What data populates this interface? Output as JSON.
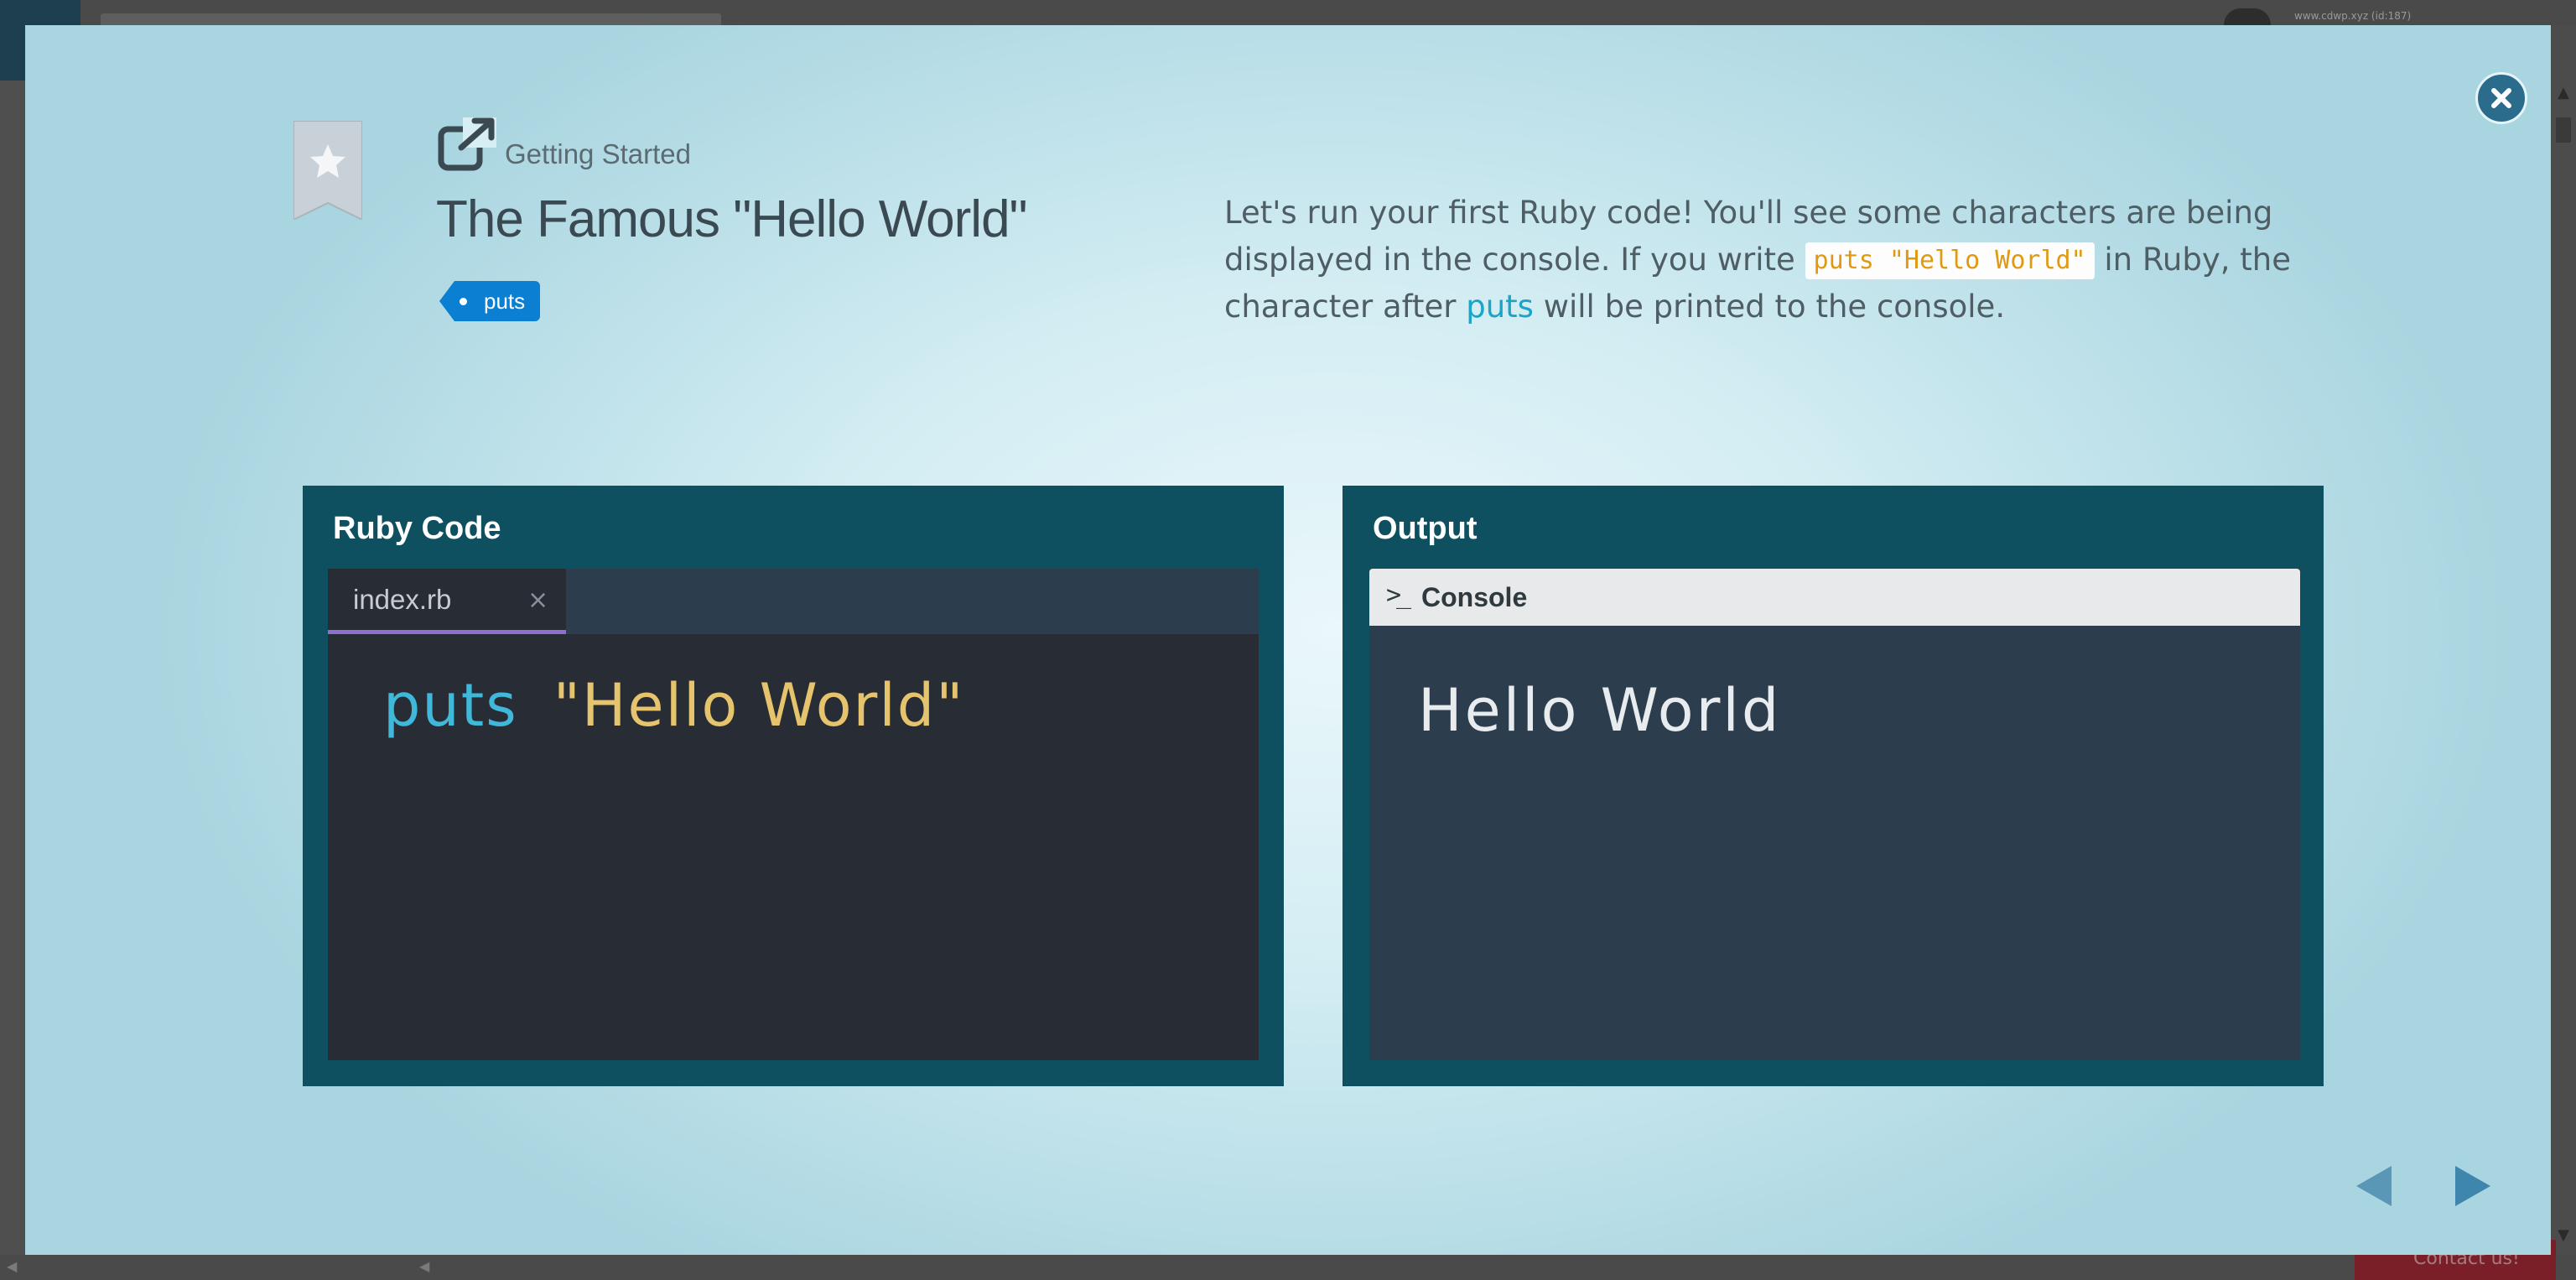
{
  "background": {
    "user_text": "www.cdwp.xyz (id:187)",
    "contact_label": "Contact us!"
  },
  "modal": {
    "icons": {
      "bookmark": "star-bookmark-icon",
      "external": "external-link-icon",
      "close": "close-icon",
      "prev": "arrow-left-icon",
      "next": "arrow-right-icon"
    },
    "category": "Getting Started",
    "title": "The Famous \"Hello World\"",
    "tag": "puts",
    "description": {
      "part1": "Let's run your first Ruby code! You'll see some characters are being displayed in the console. If you write ",
      "code": "puts \"Hello World\"",
      "part2": " in Ruby, the character after ",
      "keyword": "puts",
      "part3": " will be printed to the console."
    },
    "code_panel": {
      "title": "Ruby Code",
      "tab_name": "index.rb",
      "tab_close": "×",
      "code_keyword": "puts",
      "code_string": "\"Hello World\""
    },
    "output_panel": {
      "title": "Output",
      "console_prompt": ">_",
      "console_label": "Console",
      "output_text": "Hello World"
    }
  },
  "colors": {
    "panel_bg": "#0f5060",
    "editor_bg": "#282c34",
    "console_bg": "#2c3d4e",
    "tag_blue": "#0b7fd1",
    "code_keyword": "#3fb8da",
    "code_string": "#e6c46d",
    "tab_underline": "#8c6fd0"
  }
}
